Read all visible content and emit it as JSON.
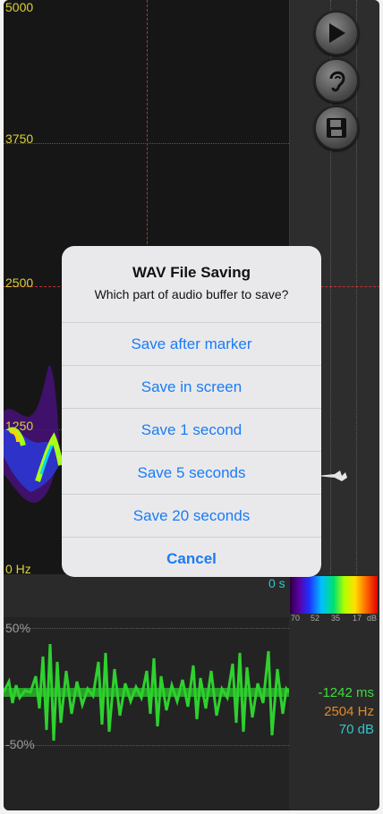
{
  "spectrogram": {
    "y_labels": [
      "5000",
      "3750",
      "2500",
      "1250",
      "0 Hz"
    ],
    "time_label": "0 s"
  },
  "colorbar": {
    "labels": [
      "70",
      "52",
      "35",
      "17",
      "dB"
    ]
  },
  "waveform": {
    "top_label": "50%",
    "bottom_label": "-50%"
  },
  "readouts": {
    "time": "-1242 ms",
    "freq": "2504 Hz",
    "level": "70 dB",
    "colors": {
      "time": "#3ddc3d",
      "freq": "#e08a2a",
      "level": "#35c4c8"
    }
  },
  "controls": {
    "icons": [
      "play-icon",
      "ear-icon",
      "save-disk-icon"
    ]
  },
  "dialog": {
    "title": "WAV File Saving",
    "message": "Which part of audio buffer to save?",
    "options": [
      "Save after marker",
      "Save in screen",
      "Save 1 second",
      "Save 5 seconds",
      "Save 20 seconds"
    ],
    "cancel": "Cancel",
    "accent": "#1a7cf5"
  }
}
